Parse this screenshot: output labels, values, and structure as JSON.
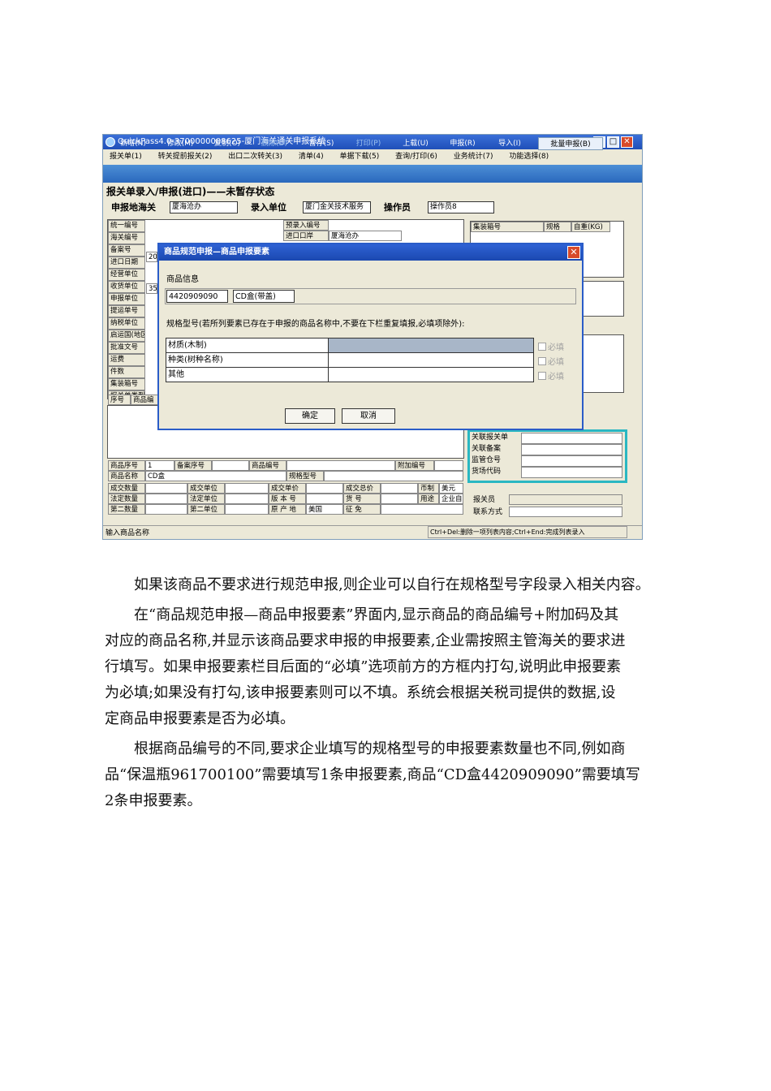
{
  "window": {
    "title": "QuickPass4.0-3700000008625-厦门海关通关申报系统",
    "controls": [
      "_",
      "□",
      "✕"
    ]
  },
  "menu": [
    "报关单(1)",
    "转关提前报关(2)",
    "出口二次转关(3)",
    "清单(4)",
    "单据下载(5)",
    "查询/打印(6)",
    "业务统计(7)",
    "功能选择(8)"
  ],
  "toolbar": {
    "new": "新增(N)",
    "edit": "修改(M)",
    "copy": "复制(O)",
    "delete": "删除(D)",
    "save": "暂存(S)",
    "print": "打印(P)",
    "upload": "上载(U)",
    "declare": "申报(R)",
    "import": "导入(I)",
    "batch": "批量申报(B)"
  },
  "form": {
    "heading": "报关单录入/申报(进口)——未暂存状态",
    "customs_label": "申报地海关",
    "customs_value": "厦海沧办",
    "unit_label": "录入单位",
    "unit_value": "厦门金关技术服务",
    "operator_label": "操作员",
    "operator_value": "操作员8",
    "left_labels": [
      "统一编号",
      "海关编号",
      "备案号",
      "进口日期",
      "经营单位",
      "收货单位",
      "申报单位",
      "提运单号",
      "纳税单位",
      "启运国(地区)",
      "批准文号",
      "运费",
      "件数",
      "集装箱号",
      "报关单类型"
    ],
    "import_date_partial": "200",
    "decl_unit_partial": "350",
    "pre_entry_label": "预录入编号",
    "port_label": "进口口岸",
    "port_value": "厦海沧办",
    "container_headers": [
      "集装箱号",
      "规格",
      "自重(KG)"
    ],
    "list_headers": [
      "序号",
      "商品编"
    ],
    "item": {
      "seq_label": "商品序号",
      "seq_value": "1",
      "record_seq_label": "备案序号",
      "code_label": "商品编号",
      "extra_code_label": "附加编号",
      "name_label": "商品名称",
      "name_value": "CD盒",
      "spec_label": "规格型号",
      "row1": [
        "成交数量",
        "成交单位",
        "成交单价",
        "成交总价",
        "币制",
        "美元"
      ],
      "row2": [
        "法定数量",
        "法定单位",
        "版 本 号",
        "货 号",
        "用途",
        "企业自"
      ],
      "row3": [
        "第二数量",
        "第二单位",
        "原 产 地",
        "美国",
        "征 免"
      ]
    },
    "right_labels": [
      "关联报关单",
      "关联备案",
      "监管仓号",
      "货场代码"
    ],
    "declarant_label": "报关员",
    "contact_label": "联系方式"
  },
  "statusbar": {
    "left": "输入商品名称",
    "right": "Ctrl+Del:删除一项列表内容;Ctrl+End:完成列表录入"
  },
  "dialog": {
    "title": "商品规范申报—商品申报要素",
    "info_label": "商品信息",
    "code": "4420909090",
    "name": "CD盒(带盖)",
    "spec_hint": "规格型号(若所列要素已存在于申报的商品名称中,不要在下栏重复填报,必填项除外):",
    "elements": [
      {
        "name": "材质(木制)",
        "value": "",
        "required": "必填"
      },
      {
        "name": "种类(树种名称)",
        "value": "",
        "required": "必填"
      },
      {
        "name": "其他",
        "value": "",
        "required": "必填"
      }
    ],
    "ok": "确定",
    "cancel": "取消"
  },
  "paragraphs": [
    "如果该商品不要求进行规范申报,则企业可以自行在规格型号字段录入相关内容。",
    "在“商品规范申报—商品申报要素”界面内,显示商品的商品编号+附加码及其",
    "对应的商品名称,并显示该商品要求申报的申报要素,企业需按照主管海关的要求进",
    "行填写。如果申报要素栏目后面的“必填”选项前方的方框内打勾,说明此申报要素",
    "为必填;如果没有打勾,该申报要素则可以不填。系统会根据关税司提供的数据,设",
    "定商品申报要素是否为必填。",
    "根据商品编号的不同,要求企业填写的规格型号的申报要素数量也不同,例如商",
    "品“保温瓶961700100”需要填写1条申报要素,商品“CD盒4420909090”需要填写",
    "2条申报要素。"
  ]
}
